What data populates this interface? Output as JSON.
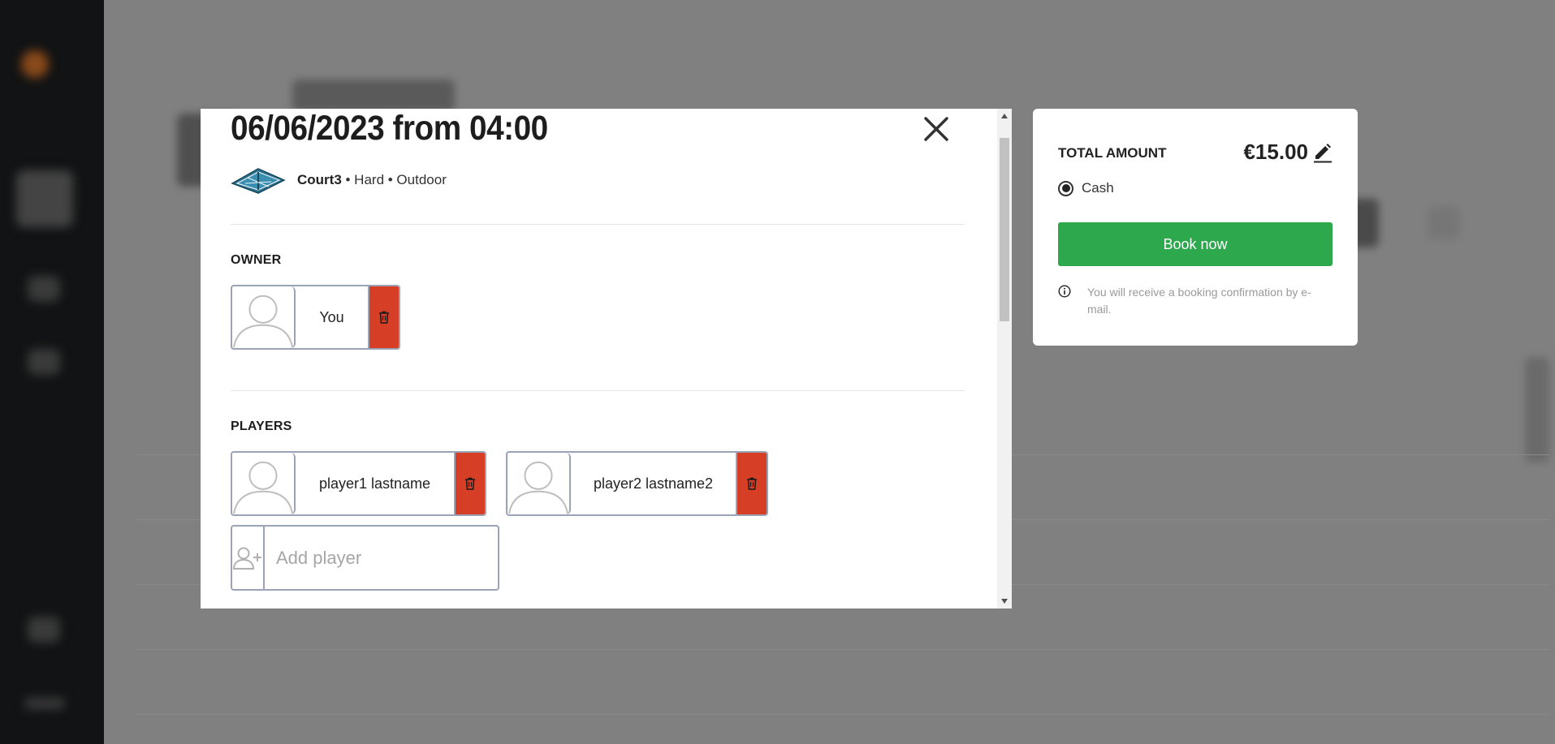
{
  "modal": {
    "title": "06/06/2023 from 04:00",
    "court": {
      "name": "Court3",
      "details": " • Hard • Outdoor"
    },
    "owner": {
      "label": "OWNER",
      "name": "You"
    },
    "players": {
      "label": "PLAYERS",
      "items": [
        {
          "name": "player1 lastname"
        },
        {
          "name": "player2 lastname2"
        }
      ],
      "add_placeholder": "Add player"
    }
  },
  "summary": {
    "total_label": "TOTAL AMOUNT",
    "total_amount": "€15.00",
    "payment_method": "Cash",
    "payment_selected": true,
    "book_label": "Book now",
    "info_text": "You will receive a booking confirmation by e-mail."
  },
  "colors": {
    "accent_green": "#2ea84d",
    "delete_red": "#d63f26",
    "overlay_gray": "#7f7f7f",
    "border": "#9aa4b6"
  },
  "icons": [
    "close-icon",
    "court-icon",
    "trash-icon",
    "avatar-icon",
    "add-user-icon",
    "pencil-icon",
    "info-icon",
    "scroll-up-icon",
    "scroll-down-icon"
  ]
}
